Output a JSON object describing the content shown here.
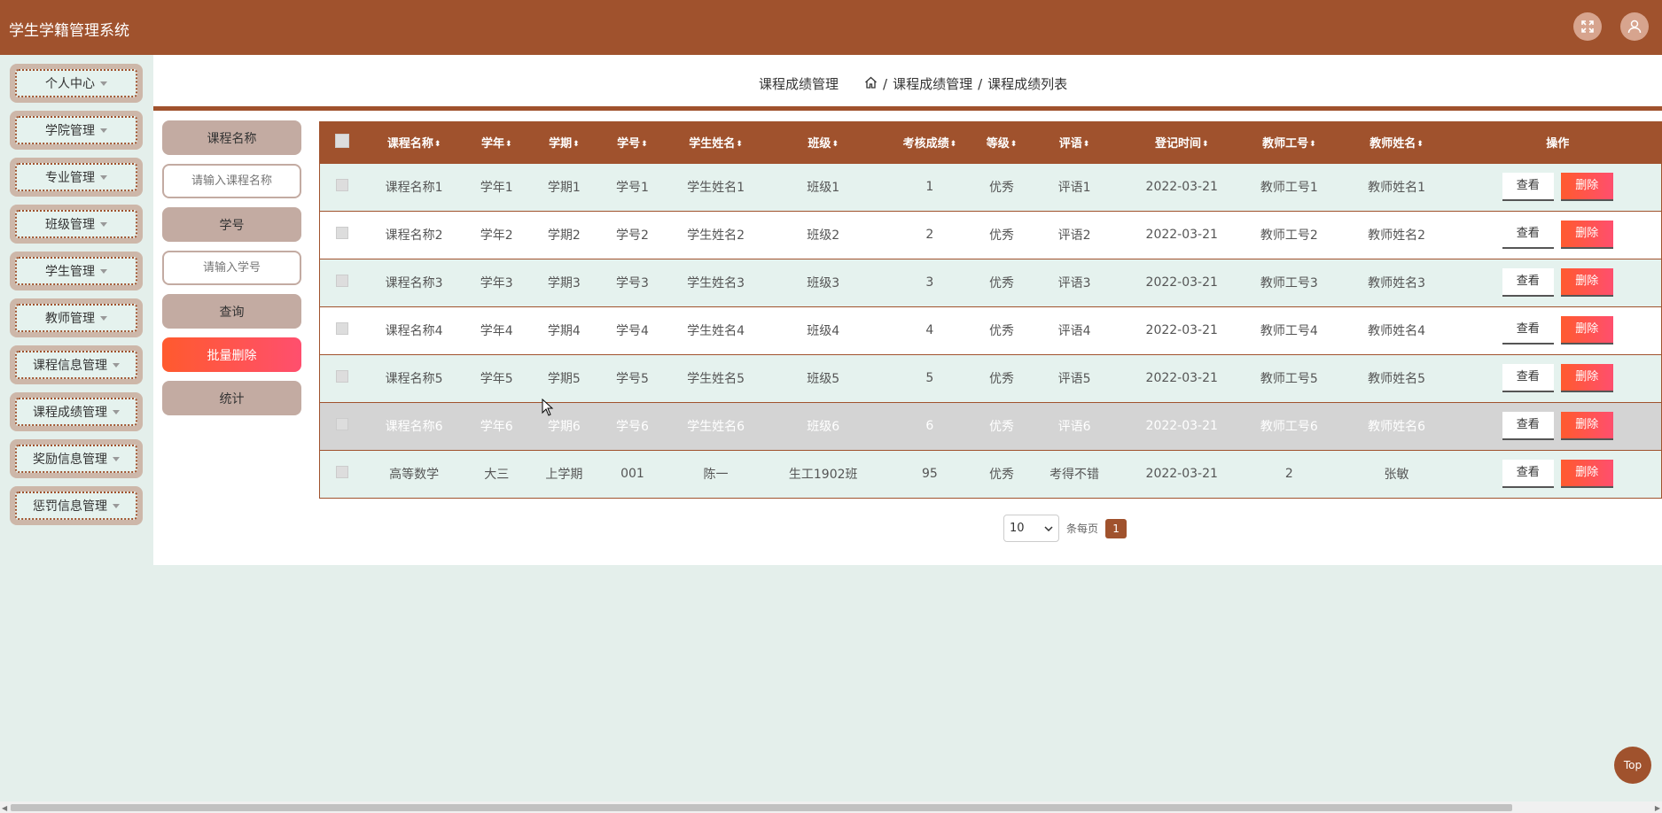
{
  "app": {
    "title": "学生学籍管理系统"
  },
  "sidebar": {
    "items": [
      {
        "label": "个人中心"
      },
      {
        "label": "学院管理"
      },
      {
        "label": "专业管理"
      },
      {
        "label": "班级管理"
      },
      {
        "label": "学生管理"
      },
      {
        "label": "教师管理"
      },
      {
        "label": "课程信息管理"
      },
      {
        "label": "课程成绩管理"
      },
      {
        "label": "奖励信息管理"
      },
      {
        "label": "惩罚信息管理"
      }
    ]
  },
  "header": {
    "page_title": "课程成绩管理",
    "breadcrumb": [
      "课程成绩管理",
      "课程成绩列表"
    ],
    "sep": "/"
  },
  "search": {
    "course_label": "课程名称",
    "course_placeholder": "请输入课程名称",
    "id_label": "学号",
    "id_placeholder": "请输入学号",
    "query_btn": "查询",
    "batch_delete_btn": "批量删除",
    "stats_btn": "统计"
  },
  "table": {
    "columns": [
      "课程名称",
      "学年",
      "学期",
      "学号",
      "学生姓名",
      "班级",
      "考核成绩",
      "等级",
      "评语",
      "登记时间",
      "教师工号",
      "教师姓名",
      "操作"
    ],
    "sort_icon": "⬍",
    "rows": [
      [
        "课程名称1",
        "学年1",
        "学期1",
        "学号1",
        "学生姓名1",
        "班级1",
        "1",
        "优秀",
        "评语1",
        "2022-03-21",
        "教师工号1",
        "教师姓名1"
      ],
      [
        "课程名称2",
        "学年2",
        "学期2",
        "学号2",
        "学生姓名2",
        "班级2",
        "2",
        "优秀",
        "评语2",
        "2022-03-21",
        "教师工号2",
        "教师姓名2"
      ],
      [
        "课程名称3",
        "学年3",
        "学期3",
        "学号3",
        "学生姓名3",
        "班级3",
        "3",
        "优秀",
        "评语3",
        "2022-03-21",
        "教师工号3",
        "教师姓名3"
      ],
      [
        "课程名称4",
        "学年4",
        "学期4",
        "学号4",
        "学生姓名4",
        "班级4",
        "4",
        "优秀",
        "评语4",
        "2022-03-21",
        "教师工号4",
        "教师姓名4"
      ],
      [
        "课程名称5",
        "学年5",
        "学期5",
        "学号5",
        "学生姓名5",
        "班级5",
        "5",
        "优秀",
        "评语5",
        "2022-03-21",
        "教师工号5",
        "教师姓名5"
      ],
      [
        "课程名称6",
        "学年6",
        "学期6",
        "学号6",
        "学生姓名6",
        "班级6",
        "6",
        "优秀",
        "评语6",
        "2022-03-21",
        "教师工号6",
        "教师姓名6"
      ],
      [
        "高等数学",
        "大三",
        "上学期",
        "001",
        "陈一",
        "生工1902班",
        "95",
        "优秀",
        "考得不错",
        "2022-03-21",
        "2",
        "张敏"
      ]
    ],
    "view_btn": "查看",
    "delete_btn": "删除"
  },
  "pagination": {
    "page_size": "10",
    "per_page_label": "条每页",
    "current_page": "1"
  },
  "top_button": "Top",
  "colors": {
    "brand": "#a0522d",
    "danger": "#ff5a2e",
    "bg": "#e4efeb"
  }
}
